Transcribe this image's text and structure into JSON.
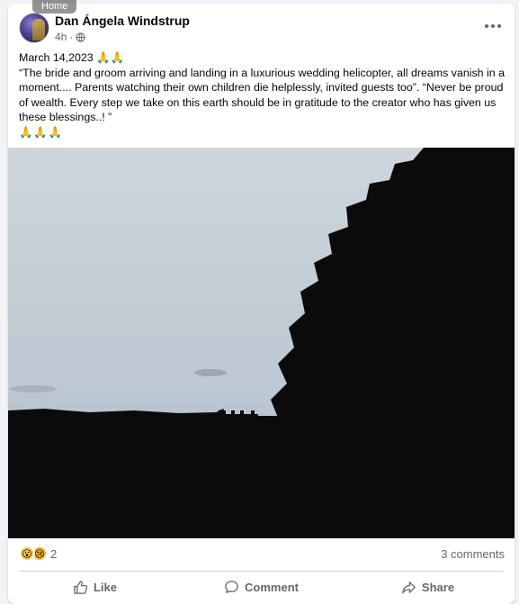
{
  "tooltip": "Home",
  "post": {
    "author": "Dan Ángela Windstrup",
    "time": "4h",
    "date_line": "March 14,2023 🙏🙏",
    "body": "“The bride and groom arriving and landing in a luxurious wedding helicopter, all dreams vanish in a moment....  Parents watching their own children die helplessly,  invited guests too”.   “Never be proud of wealth.  Every step we take on this earth should be in gratitude to the creator who has given us these blessings..! ”",
    "closing": "🙏🙏🙏"
  },
  "reactions": {
    "icons": [
      "wow-icon",
      "sad-icon"
    ],
    "count": "2",
    "comments": "3 comments"
  },
  "actions": {
    "like": "Like",
    "comment": "Comment",
    "share": "Share"
  },
  "colors": {
    "secondary_text": "#65676b",
    "sky_top": "#c9d3da",
    "sky_bottom": "#b6c4d0",
    "silhouette": "#0b0b0c"
  }
}
